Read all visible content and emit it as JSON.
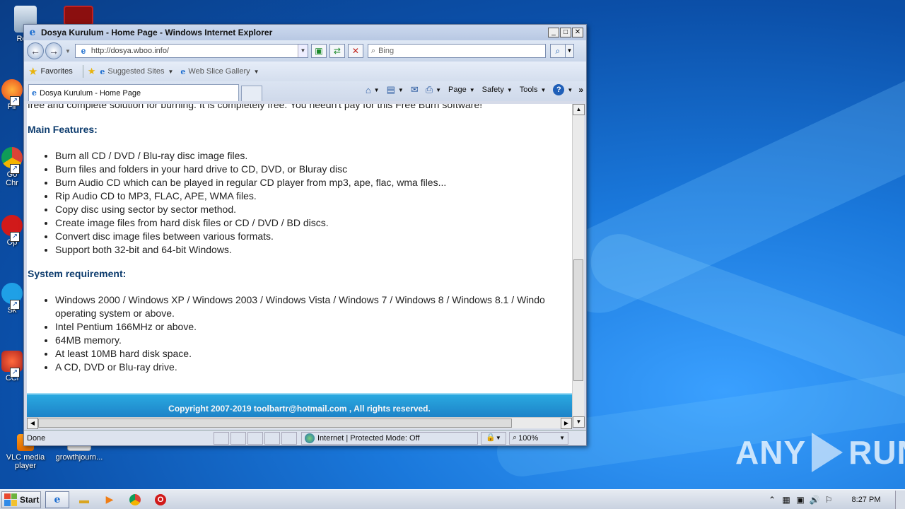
{
  "window": {
    "title": "Dosya Kurulum - Home Page - Windows Internet Explorer",
    "controls": [
      "_",
      "□",
      "✕"
    ]
  },
  "address": {
    "url": "http://dosya.wboo.info/",
    "search_placeholder": "Bing"
  },
  "favorites_bar": {
    "favorites_label": "Favorites",
    "suggested_sites": "Suggested Sites",
    "web_slice_gallery": "Web Slice Gallery"
  },
  "tabs": [
    {
      "label": "Dosya Kurulum - Home Page"
    }
  ],
  "command_bar": {
    "page": "Page",
    "safety": "Safety",
    "tools": "Tools"
  },
  "page": {
    "cut_line": "free and complete solution for burning. It is completely free. You needn't pay for this Free Burn software!",
    "main_features_title": "Main Features:",
    "features": [
      "Burn all CD / DVD / Blu-ray disc image files.",
      "Burn files and folders in your hard drive to CD, DVD, or Bluray disc",
      "Burn Audio CD which can be played in regular CD player from mp3, ape, flac, wma files...",
      "Rip Audio CD to MP3, FLAC, APE, WMA files.",
      "Copy disc using sector by sector method.",
      "Create image files from hard disk files or CD / DVD / BD discs.",
      "Convert disc image files between various formats.",
      "Support both 32-bit and 64-bit Windows."
    ],
    "system_req_title": "System requirement:",
    "requirements": [
      "Windows 2000 / Windows XP / Windows 2003 / Windows Vista / Windows 7 / Windows 8 / Windows 8.1 / Windo",
      "Intel Pentium 166MHz or above.",
      "64MB memory.",
      "At least 10MB hard disk space.",
      "A CD, DVD or Blu-ray drive."
    ],
    "requirement_wrap": "operating system or above.",
    "footer": "Copyright 2007-2019 toolbartr@hotmail.com , All rights reserved."
  },
  "status_bar": {
    "status": "Done",
    "zone": "Internet | Protected Mode: Off",
    "zoom": "100%"
  },
  "desktop_icons": {
    "recycle": "Recy",
    "firefox": "Fir",
    "chrome_line1": "Go",
    "chrome_line2": "Chr",
    "opera": "Op",
    "skype": "Sk",
    "ccleaner": "CCl",
    "vlc_line1": "VLC media",
    "vlc_line2": "player",
    "growth": "growthjourn..."
  },
  "taskbar": {
    "start_label": "Start",
    "clock": "8:27 PM"
  },
  "watermark": {
    "left": "ANY",
    "right": "RUN"
  },
  "colors": {
    "section_title": "#0d3c6e",
    "footer_bg": "#1b7cc4",
    "desktop": "#1a78db"
  }
}
